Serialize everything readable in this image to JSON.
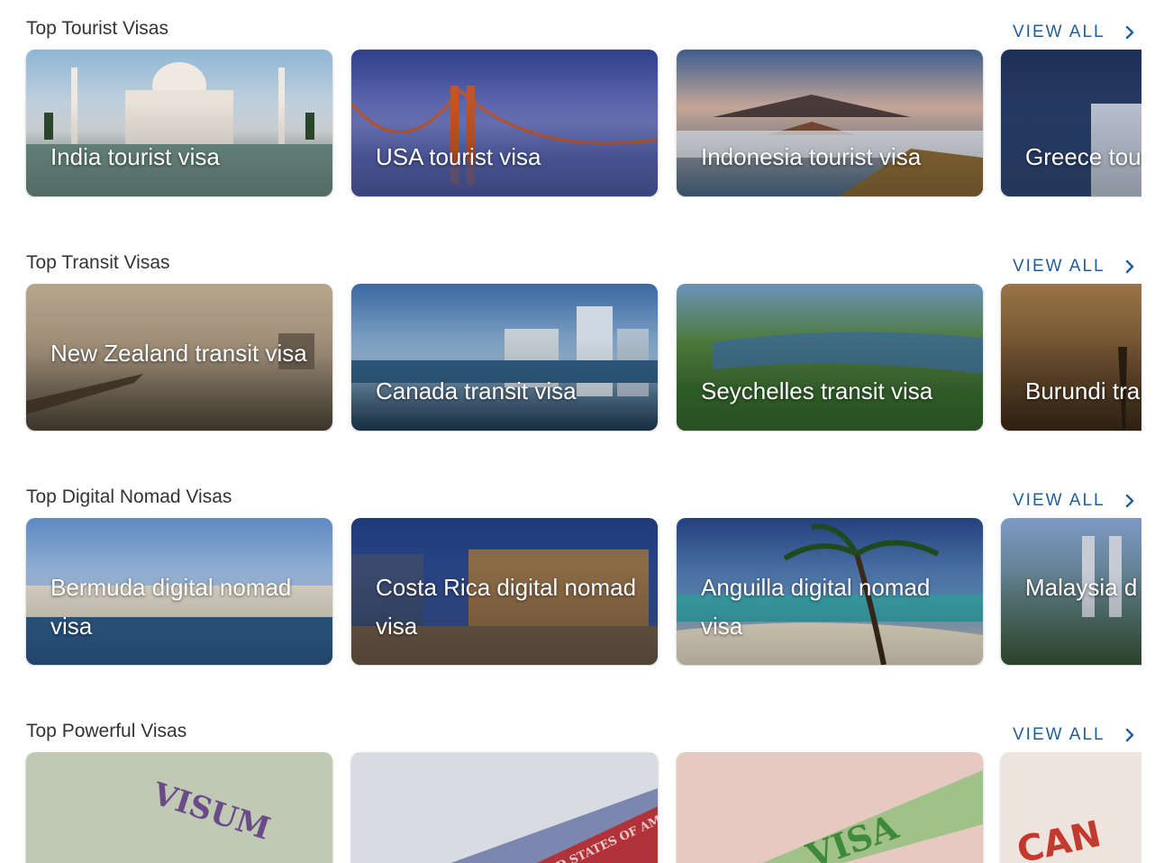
{
  "view_all_label": "VIEW ALL",
  "sections": [
    {
      "title": "Top Tourist Visas",
      "cards": [
        {
          "label": "India tourist visa"
        },
        {
          "label": "USA tourist visa"
        },
        {
          "label": "Indonesia tourist visa"
        },
        {
          "label": "Greece tou"
        }
      ]
    },
    {
      "title": "Top Transit Visas",
      "cards": [
        {
          "label": "New Zealand transit visa"
        },
        {
          "label": "Canada transit visa"
        },
        {
          "label": "Seychelles transit visa"
        },
        {
          "label": "Burundi tra"
        }
      ]
    },
    {
      "title": "Top Digital Nomad Visas",
      "cards": [
        {
          "label": "Bermuda digital nomad visa"
        },
        {
          "label": "Costa Rica digital nomad visa"
        },
        {
          "label": "Anguilla digital nomad visa"
        },
        {
          "label": "Malaysia d visa"
        }
      ]
    },
    {
      "title": "Top Powerful Visas",
      "cards": [
        {
          "label": "",
          "stamp": "VISUM"
        },
        {
          "label": "",
          "stamp": "UNITED STATES OF AMERICA"
        },
        {
          "label": "",
          "stamp": "VISA"
        },
        {
          "label": "",
          "stamp": "CAN"
        }
      ]
    }
  ],
  "colors": {
    "accent": "#1f5f99",
    "title_text": "#333333"
  },
  "icons": {
    "view_all": "chevron-right-icon"
  }
}
